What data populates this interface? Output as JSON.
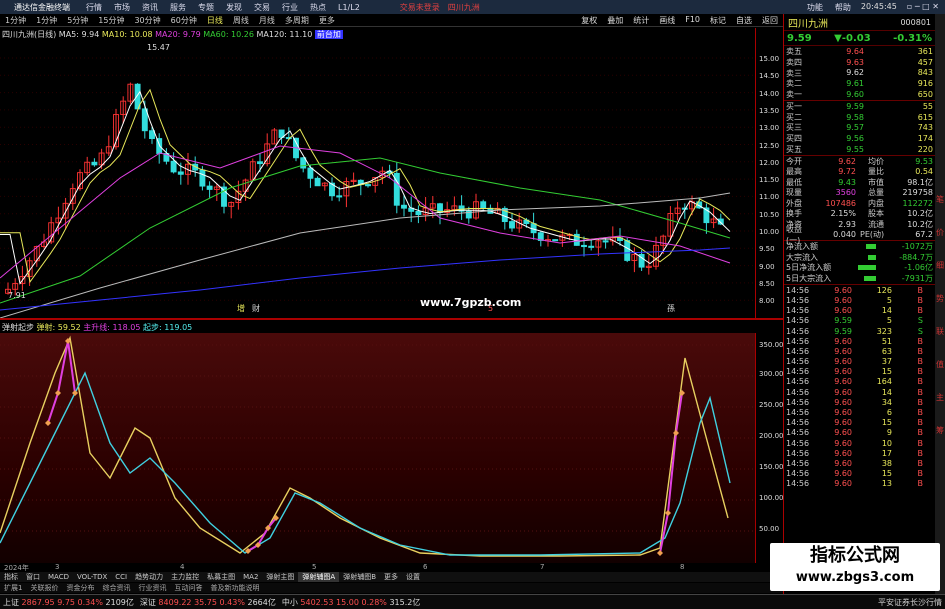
{
  "menubar": {
    "app_title": "通达信金融终端",
    "items": [
      "行情",
      "市场",
      "资讯",
      "服务",
      "专题",
      "发现",
      "交易",
      "行业",
      "热点",
      "L1/L2"
    ],
    "notice": "交易未登录",
    "stock": "四川九洲",
    "right": [
      "功能",
      "帮助"
    ],
    "time": "20:45:45"
  },
  "toolbar": {
    "periods": [
      "1分钟",
      "1分钟",
      "5分钟",
      "15分钟",
      "30分钟",
      "60分钟",
      "日线",
      "周线",
      "月线",
      "多周期",
      "更多"
    ],
    "active": "日线",
    "right": [
      "复权",
      "叠加",
      "统计",
      "画线",
      "F10",
      "标记",
      "自选",
      "返回"
    ]
  },
  "main_legend": {
    "name": "四川九洲(日线)",
    "ma5": "MA5: 9.94",
    "ma10": "MA10: 10.08",
    "ma20": "MA20: 9.79",
    "ma60": "MA60: 10.26",
    "ma120": "MA120: 11.10",
    "extra": "前台加",
    "high_label": "15.47",
    "low_label": "7.91"
  },
  "price_axis": [
    "15.00",
    "14.50",
    "14.00",
    "13.50",
    "13.00",
    "12.50",
    "12.00",
    "11.50",
    "11.00",
    "10.50",
    "10.00",
    "9.50",
    "9.00",
    "8.50",
    "8.00"
  ],
  "chart_markers": {
    "m1": "增",
    "m2": "财",
    "m3": "5",
    "m4": "孫"
  },
  "site_text": "www.7gpzb.com",
  "ind_legend": {
    "name": "弹射起步",
    "v1": "弹射: 59.52",
    "v2": "主升线: 118.05",
    "v3": "起步: 119.05"
  },
  "ind_axis": [
    "350.00",
    "300.00",
    "250.00",
    "200.00",
    "150.00",
    "100.00",
    "50.00"
  ],
  "date_axis": [
    "2024年",
    "3",
    "4",
    "5",
    "6",
    "7",
    "8"
  ],
  "bottom_tabs": [
    "指标",
    "窗口",
    "MACD",
    "VOL-TDX",
    "CCI",
    "趋势动力",
    "主力监控",
    "私募主图",
    "MA2",
    "弹射主图",
    "弹射辅图A",
    "弹射辅图B",
    "更多",
    "设置"
  ],
  "bottom_tabs2": [
    "扩展1",
    "关联报价",
    "资金分布",
    "综合资讯",
    "行业资讯",
    "互动问答",
    "普及新功能说明"
  ],
  "right_panel": {
    "name": "四川九洲",
    "code": "000801",
    "price": "9.59",
    "change": "-0.03",
    "pct": "-0.31%",
    "asks": [
      {
        "l": "卖五",
        "p": "9.64",
        "v": "361"
      },
      {
        "l": "卖四",
        "p": "9.63",
        "v": "457"
      },
      {
        "l": "卖三",
        "p": "9.62",
        "v": "843"
      },
      {
        "l": "卖二",
        "p": "9.61",
        "v": "916"
      },
      {
        "l": "卖一",
        "p": "9.60",
        "v": "650"
      }
    ],
    "bids": [
      {
        "l": "买一",
        "p": "9.59",
        "v": "55"
      },
      {
        "l": "买二",
        "p": "9.58",
        "v": "615"
      },
      {
        "l": "买三",
        "p": "9.57",
        "v": "743"
      },
      {
        "l": "买四",
        "p": "9.56",
        "v": "174"
      },
      {
        "l": "买五",
        "p": "9.55",
        "v": "220"
      }
    ],
    "stats": [
      {
        "a": "今开",
        "b": "9.62",
        "c": "均价",
        "d": "9.53"
      },
      {
        "a": "最高",
        "b": "9.72",
        "c": "量比",
        "d": "0.54"
      },
      {
        "a": "最低",
        "b": "9.43",
        "c": "市值",
        "d": "98.1亿"
      },
      {
        "a": "现量",
        "b": "3560",
        "c": "总量",
        "d": "219758"
      },
      {
        "a": "外盘",
        "b": "107486",
        "c": "内盘",
        "d": "112272"
      },
      {
        "a": "换手",
        "b": "2.15%",
        "c": "股本",
        "d": "10.2亿"
      },
      {
        "a": "净资",
        "b": "2.93",
        "c": "流通",
        "d": "10.2亿"
      },
      {
        "a": "收益(一)",
        "b": "0.040",
        "c": "PE(动)",
        "d": "67.2"
      }
    ],
    "flows": [
      {
        "a": "净流入额",
        "v": "-1072万"
      },
      {
        "a": "大宗流入",
        "v": "-884.7万"
      },
      {
        "a": "5日净流入额",
        "v": "-1.06亿"
      },
      {
        "a": "5日大宗流入",
        "v": "-7931万"
      }
    ],
    "ticks": [
      {
        "t": "14:56",
        "p": "9.60",
        "v": "126",
        "f": "B"
      },
      {
        "t": "14:56",
        "p": "9.60",
        "v": "5",
        "f": "B"
      },
      {
        "t": "14:56",
        "p": "9.60",
        "v": "14",
        "f": "B"
      },
      {
        "t": "14:56",
        "p": "9.59",
        "v": "5",
        "f": "S"
      },
      {
        "t": "14:56",
        "p": "9.59",
        "v": "323",
        "f": "S"
      },
      {
        "t": "14:56",
        "p": "9.60",
        "v": "51",
        "f": "B"
      },
      {
        "t": "14:56",
        "p": "9.60",
        "v": "63",
        "f": "B"
      },
      {
        "t": "14:56",
        "p": "9.60",
        "v": "37",
        "f": "B"
      },
      {
        "t": "14:56",
        "p": "9.60",
        "v": "15",
        "f": "B"
      },
      {
        "t": "14:56",
        "p": "9.60",
        "v": "164",
        "f": "B"
      },
      {
        "t": "14:56",
        "p": "9.60",
        "v": "14",
        "f": "B"
      },
      {
        "t": "14:56",
        "p": "9.60",
        "v": "34",
        "f": "B"
      },
      {
        "t": "14:56",
        "p": "9.60",
        "v": "6",
        "f": "B"
      },
      {
        "t": "14:56",
        "p": "9.60",
        "v": "15",
        "f": "B"
      },
      {
        "t": "14:56",
        "p": "9.60",
        "v": "9",
        "f": "B"
      },
      {
        "t": "14:56",
        "p": "9.60",
        "v": "10",
        "f": "B"
      },
      {
        "t": "14:56",
        "p": "9.60",
        "v": "17",
        "f": "B"
      },
      {
        "t": "14:56",
        "p": "9.60",
        "v": "38",
        "f": "B"
      },
      {
        "t": "14:56",
        "p": "9.60",
        "v": "15",
        "f": "B"
      },
      {
        "t": "14:56",
        "p": "9.60",
        "v": "13",
        "f": "B"
      }
    ],
    "side_tabs": [
      "笔",
      "价",
      "细",
      "势",
      "联",
      "值",
      "主",
      "筹"
    ]
  },
  "status": {
    "sh_label": "上证",
    "sh": "2867.95",
    "sh_ch": "9.75",
    "sh_pct": "0.34%",
    "sh_amt": "2109亿",
    "sz_label": "深证",
    "sz": "8409.22",
    "sz_ch": "35.75",
    "sz_pct": "0.43%",
    "sz_amt": "2664亿",
    "zx_label": "中小",
    "zx": "5402.53",
    "zx_ch": "15.00",
    "zx_pct": "0.28%",
    "zx_amt": "315.2亿",
    "broker": "平安证券长沙行情"
  },
  "watermark": {
    "line1": "指标公式网",
    "line2": "www.zbgs3.com"
  },
  "colors": {
    "up": "#ff3333",
    "down": "#33dddd",
    "ma5": "#ffffff",
    "ma10": "#e8e85a",
    "ma20": "#e040e0",
    "ma60": "#33cc33",
    "ma120": "#bbbbbb",
    "extra": "#3333ff",
    "ind_yellow": "#e8d060",
    "ind_cyan": "#40d0e0",
    "ind_magenta": "#e040e0"
  }
}
